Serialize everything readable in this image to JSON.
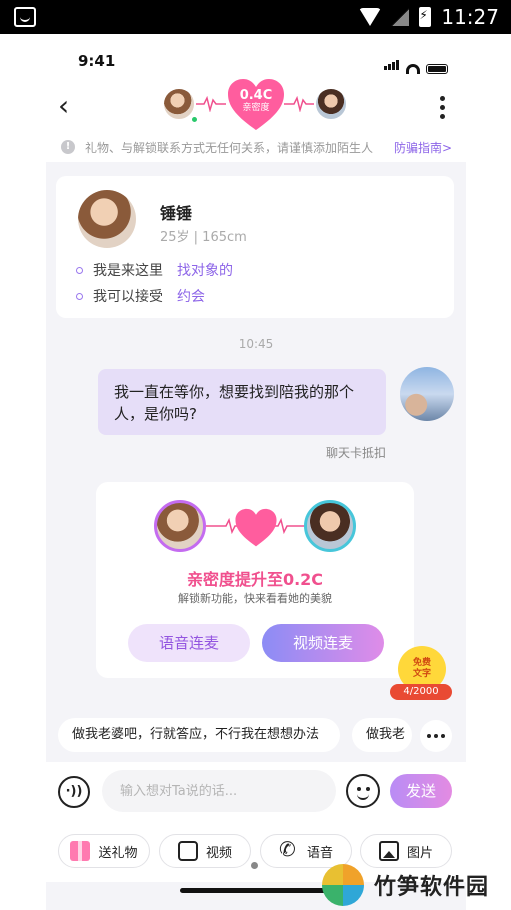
{
  "android_status": {
    "time": "11:27"
  },
  "ios_status": {
    "time": "9:41"
  },
  "nav": {
    "intimacy_value": "0.4C",
    "intimacy_label": "亲密度"
  },
  "notice": {
    "text": "礼物、与解锁联系方式无任何关系，请谨慎添加陌生人",
    "link": "防骗指南>"
  },
  "profile": {
    "name": "锤锤",
    "sub": "25岁 | 165cm",
    "rows": [
      {
        "label": "我是来这里",
        "value": "找对象的"
      },
      {
        "label": "我可以接受",
        "value": "约会"
      }
    ]
  },
  "chat": {
    "timestamp": "10:45",
    "message": "我一直在等你，想要找到陪我的那个人，是你吗?",
    "message_note": "聊天卡抵扣"
  },
  "intimacy_card": {
    "title": "亲密度提升至0.2C",
    "subtitle": "解锁新功能，快来看看她的美貌",
    "voice_button": "语音连麦",
    "video_button": "视频连麦"
  },
  "free_badge": {
    "line1": "免费",
    "line2": "文字",
    "count": "4/2000"
  },
  "quick_replies": [
    "做我老婆吧，行就答应，不行我在想想办法",
    "做我老"
  ],
  "input": {
    "placeholder": "输入想对Ta说的话...",
    "send_label": "发送"
  },
  "tools": [
    {
      "label": "送礼物",
      "icon": "gift-icon"
    },
    {
      "label": "视频",
      "icon": "video-icon"
    },
    {
      "label": "语音",
      "icon": "phone-icon"
    },
    {
      "label": "图片",
      "icon": "image-icon"
    }
  ],
  "watermark": {
    "text": "竹笋软件园"
  },
  "colors": {
    "accent_purple": "#8d65e8",
    "heart_pink": "#f0508e",
    "bubble": "#e6def8",
    "online": "#29c86b"
  }
}
